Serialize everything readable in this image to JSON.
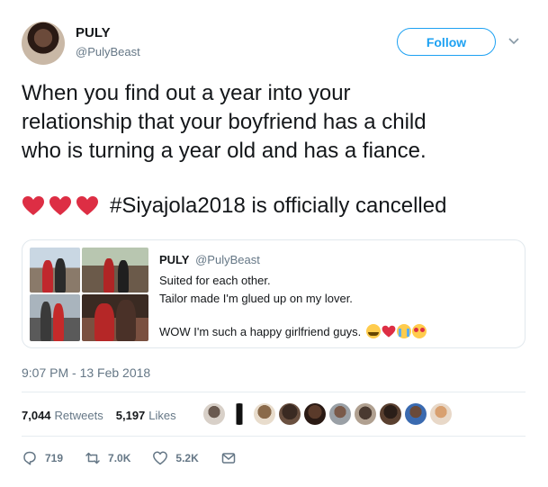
{
  "author": {
    "name": "PULY",
    "handle": "@PulyBeast"
  },
  "follow_label": "Follow",
  "icons": {
    "menu": "chevron-down-icon",
    "reply": "reply-icon",
    "retweet": "retweet-icon",
    "like": "heart-icon",
    "dm": "envelope-icon"
  },
  "tweet": {
    "text": "When you find out a year into your\nrelationship that your boyfriend has a child\nwho is turning a year old and has a fiance.",
    "hashtag_line": "#Siyajola2018 is officially cancelled"
  },
  "quote": {
    "name": "PULY",
    "handle": "@PulyBeast",
    "line1": "Suited for each other.",
    "line2": "Tailor made I'm glued up on my lover.",
    "line3": "WOW I'm such a happy girlfriend guys."
  },
  "timestamp": "9:07 PM - 13 Feb 2018",
  "stats": {
    "retweets_count": "7,044",
    "retweets_label": "Retweets",
    "likes_count": "5,197",
    "likes_label": "Likes"
  },
  "actions": {
    "reply_count": "719",
    "retweet_count": "7.0K",
    "like_count": "5.2K"
  },
  "colors": {
    "accent": "#1da1f2",
    "text": "#14171a",
    "muted": "#657786",
    "heart_red": "#e0245e"
  }
}
